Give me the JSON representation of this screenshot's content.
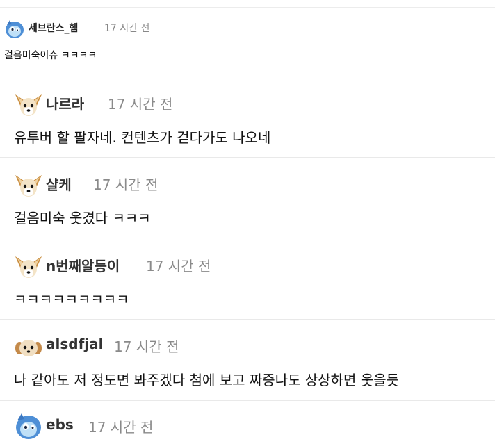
{
  "comments": [
    {
      "author": "세브란스_헴",
      "time": "17 시간 전",
      "text": "걸음미숙이슈 ㅋㅋㅋㅋ",
      "avatar": "blue-creature-avatar"
    },
    {
      "author": "나르라",
      "time": "17 시간 전",
      "text": "유투버 할 팔자네. 컨텐츠가 걷다가도 나오네",
      "avatar": "fox-dog-avatar"
    },
    {
      "author": "샬케",
      "time": "17 시간 전",
      "text": "걸음미숙 웃겼다 ㅋㅋㅋ",
      "avatar": "fox-dog-avatar"
    },
    {
      "author": "n번째알등이",
      "time": "17 시간 전",
      "text": "ㅋㅋㅋㅋㅋㅋㅋㅋㅋ",
      "avatar": "fox-dog-avatar"
    },
    {
      "author": "alsdfjal",
      "time": "17 시간 전",
      "text": "나 같아도 저 정도면 봐주겠다 첨에 보고 짜증나도 상상하면 웃을듯",
      "avatar": "puppy-avatar"
    },
    {
      "author": "ebs",
      "time": "17 시간 전",
      "text": "",
      "avatar": "blue-creature-avatar"
    }
  ],
  "colors": {
    "author": "#333333",
    "time": "#8a8a8a",
    "divider": "#e9e9e9"
  }
}
